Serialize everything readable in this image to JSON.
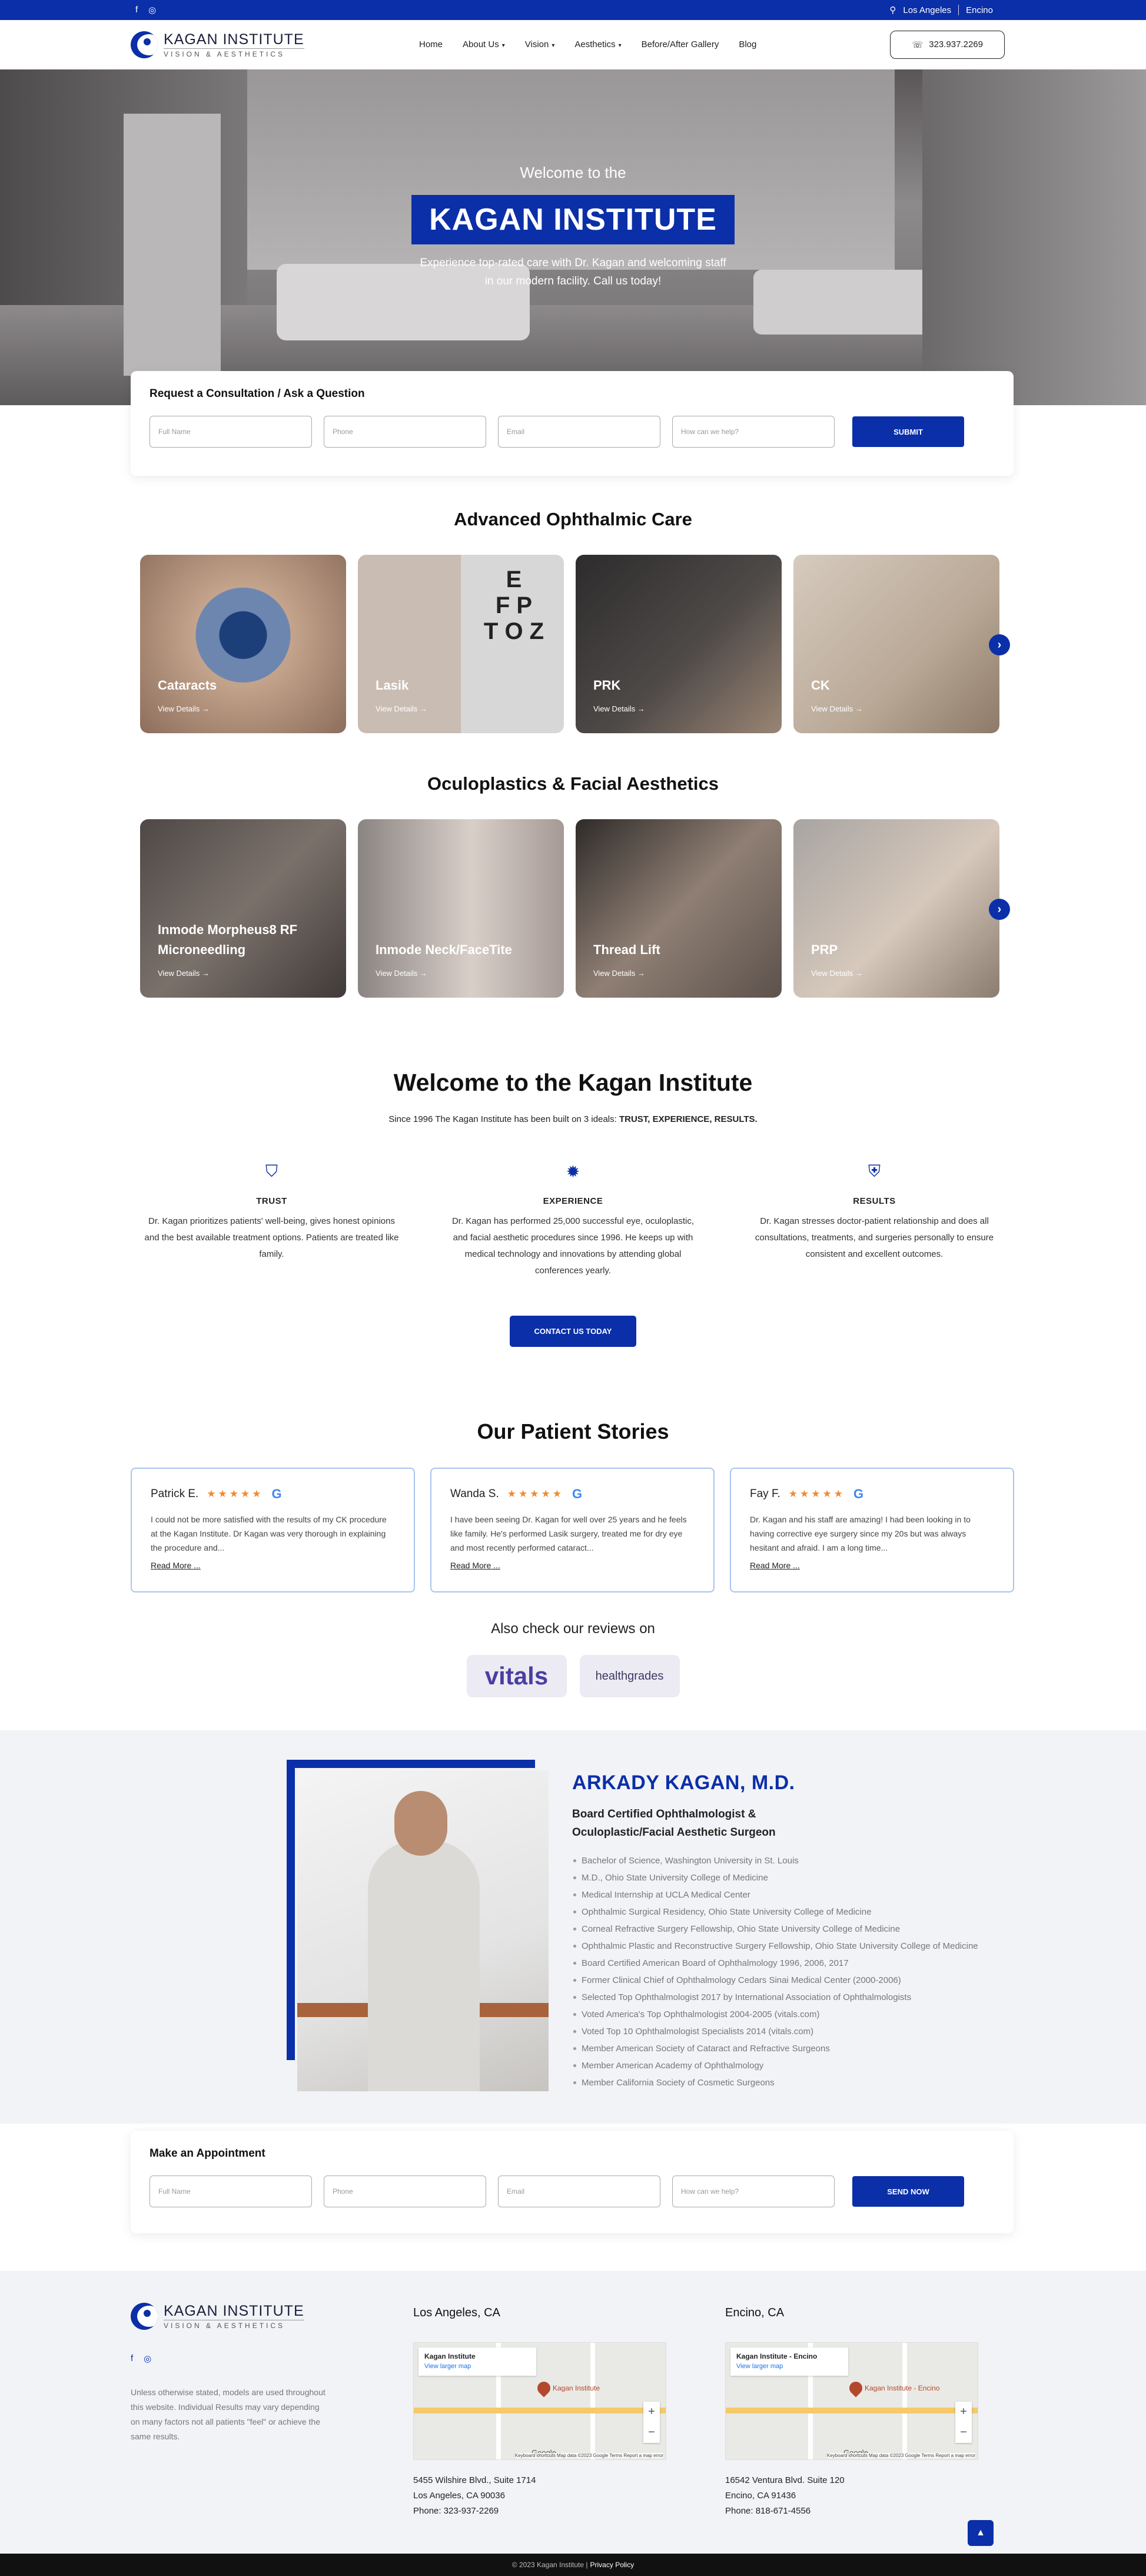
{
  "topbar": {
    "social": [
      "facebook-icon",
      "instagram-icon"
    ],
    "locations": [
      "Los Angeles",
      "Encino"
    ]
  },
  "brand": {
    "name": "KAGAN INSTITUTE",
    "tagline": "VISION & AESTHETICS"
  },
  "nav": {
    "items": [
      {
        "label": "Home",
        "has_caret": false
      },
      {
        "label": "About Us",
        "has_caret": true
      },
      {
        "label": "Vision",
        "has_caret": true
      },
      {
        "label": "Aesthetics",
        "has_caret": true
      },
      {
        "label": "Before/After Gallery",
        "has_caret": false
      },
      {
        "label": "Blog",
        "has_caret": false
      }
    ],
    "phone": "323.937.2269"
  },
  "hero": {
    "welcome": "Welcome to the",
    "title": "KAGAN INSTITUTE",
    "sub_line1": "Experience top-rated care with Dr. Kagan and welcoming staff",
    "sub_line2": "in our modern facility. Call us today!"
  },
  "consult": {
    "title": "Request a Consultation / Ask a Question",
    "fields": [
      "Full Name",
      "Phone",
      "Email",
      "How can we help?"
    ],
    "submit": "SUBMIT"
  },
  "ophthalmic": {
    "title": "Advanced Ophthalmic Care",
    "cards": [
      {
        "label": "Cataracts",
        "link": "View Details →"
      },
      {
        "label": "Lasik",
        "link": "View Details →"
      },
      {
        "label": "PRK",
        "link": "View Details →"
      },
      {
        "label": "CK",
        "link": "View Details →"
      }
    ]
  },
  "oculo": {
    "title": "Oculoplastics & Facial Aesthetics",
    "cards": [
      {
        "label": "Inmode Morpheus8 RF Microneedling",
        "link": "View Details →"
      },
      {
        "label": "Inmode Neck/FaceTite",
        "link": "View Details →"
      },
      {
        "label": "Thread Lift",
        "link": "View Details →"
      },
      {
        "label": "PRP",
        "link": "View Details →"
      }
    ]
  },
  "welcome": {
    "title": "Welcome to the Kagan Institute",
    "since_prefix": "Since 1996 The Kagan Institute has been built on 3 ideals: ",
    "since_bold": "TRUST, EXPERIENCE, RESULTS.",
    "ideals": [
      {
        "title": "TRUST",
        "text": "Dr. Kagan prioritizes patients' well-being, gives honest opinions and the best available treatment options. Patients are treated like family."
      },
      {
        "title": "EXPERIENCE",
        "text": "Dr. Kagan has performed 25,000 successful eye, oculoplastic, and facial aesthetic procedures since 1996. He keeps up with medical technology and innovations by attending global conferences yearly."
      },
      {
        "title": "RESULTS",
        "text": "Dr. Kagan stresses doctor-patient relationship and does all consultations, treatments, and surgeries personally to ensure consistent and excellent outcomes."
      }
    ],
    "cta": "CONTACT US TODAY"
  },
  "stories": {
    "title": "Our Patient Stories",
    "reviews": [
      {
        "name": "Patrick E.",
        "stars": "★★★★★",
        "text": "I could not be more satisfied with the results of my CK procedure at the Kagan Institute. Dr Kagan was very thorough in explaining the procedure and...",
        "more": "Read More ..."
      },
      {
        "name": "Wanda S.",
        "stars": "★★★★★",
        "text": "I have been seeing Dr. Kagan for well over 25 years and he feels like family. He's performed Lasik surgery, treated me for dry eye and most recently performed cataract...",
        "more": "Read More ..."
      },
      {
        "name": "Fay F.",
        "stars": "★★★★★",
        "text": "Dr. Kagan and his staff are amazing! I had been looking in to having corrective eye surgery since my 20s but was always hesitant and afraid. I am a long time...",
        "more": "Read More ..."
      }
    ],
    "also": "Also check our reviews on",
    "badges": [
      "vitals",
      "healthgrades"
    ]
  },
  "doctor": {
    "name": "ARKADY KAGAN, M.D.",
    "subtitle": "Board Certified Ophthalmologist & Oculoplastic/Facial Aesthetic Surgeon",
    "credentials": [
      "Bachelor of Science, Washington University in St. Louis",
      "M.D., Ohio State University College of Medicine",
      "Medical Internship at UCLA Medical Center",
      "Ophthalmic Surgical Residency, Ohio State University College of Medicine",
      "Corneal Refractive Surgery Fellowship, Ohio State University College of Medicine",
      "Ophthalmic Plastic and Reconstructive Surgery Fellowship, Ohio State University College of Medicine",
      "Board Certified American Board of Ophthalmology 1996, 2006, 2017",
      "Former Clinical Chief of Ophthalmology Cedars Sinai Medical Center (2000-2006)",
      "Selected Top Ophthalmologist 2017 by International Association of Ophthalmologists",
      "Voted America's Top Ophthalmologist 2004-2005 (vitals.com)",
      "Voted Top 10 Ophthalmologist Specialists 2014 (vitals.com)",
      "Member American Society of Cataract and Refractive Surgeons",
      "Member American Academy of Ophthalmology",
      "Member California Society of Cosmetic Surgeons"
    ]
  },
  "appointment": {
    "title": "Make an Appointment",
    "fields": [
      "Full Name",
      "Phone",
      "Email",
      "How can we help?"
    ],
    "submit": "SEND NOW"
  },
  "footer": {
    "disclaimer": "Unless otherwise stated, models are used throughout this website. Individual Results may vary depending on many factors not all patients \"feel\" or achieve the same results.",
    "offices": [
      {
        "title": "Los Angeles, CA",
        "map_name": "Kagan Institute",
        "map_link": "View larger map",
        "pin": "Kagan Institute",
        "address1": "5455 Wilshire Blvd., Suite 1714",
        "address2": "Los Angeles, CA 90036",
        "phone": "Phone: 323-937-2269",
        "attr": "Keyboard shortcuts  Map data ©2023 Google  Terms  Report a map error"
      },
      {
        "title": "Encino, CA",
        "map_name": "Kagan Institute - Encino",
        "map_link": "View larger map",
        "pin": "Kagan Institute - Encino",
        "address1": "16542 Ventura Blvd. Suite 120",
        "address2": "Encino, CA 91436",
        "phone": "Phone: 818-671-4556",
        "attr": "Keyboard shortcuts  Map data ©2023 Google  Terms  Report a map error"
      }
    ],
    "copyright": "© 2023 Kagan Institute |",
    "policy": "Privacy Policy"
  },
  "colors": {
    "brand_blue": "#0b2fa8",
    "star_orange": "#f08a2e",
    "footer_bg": "#f2f3f6"
  }
}
